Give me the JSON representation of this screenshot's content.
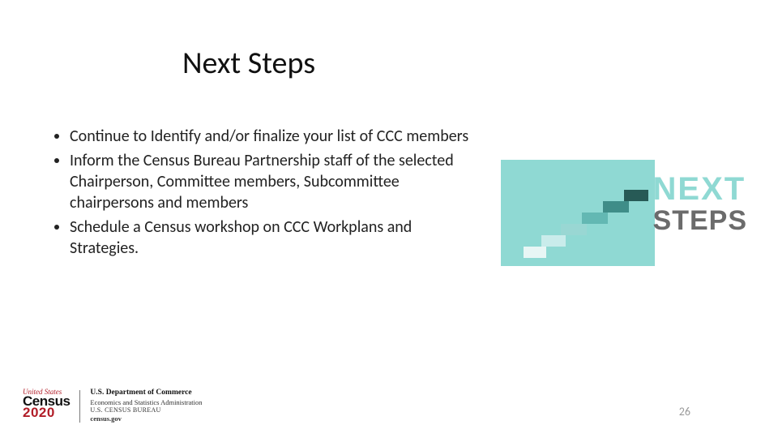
{
  "title": "Next Steps",
  "bullets": {
    "b0": "Continue to Identify and/or finalize your list of CCC members",
    "b1": "Inform the Census Bureau Partnership staff of the selected Chairperson, Committee members, Subcommittee chairpersons and members",
    "b2": "Schedule a Census workshop on CCC Workplans and Strategies."
  },
  "graphic": {
    "line1": "NEXT",
    "line2": "STEPS"
  },
  "footer": {
    "us": "United States",
    "census": "Census",
    "year": "2020",
    "dept_l1": "U.S. Department of Commerce",
    "dept_l2": "Economics and Statistics Administration",
    "dept_l3": "U.S. CENSUS BUREAU",
    "dept_l4": "census.gov"
  },
  "page_number": "26"
}
